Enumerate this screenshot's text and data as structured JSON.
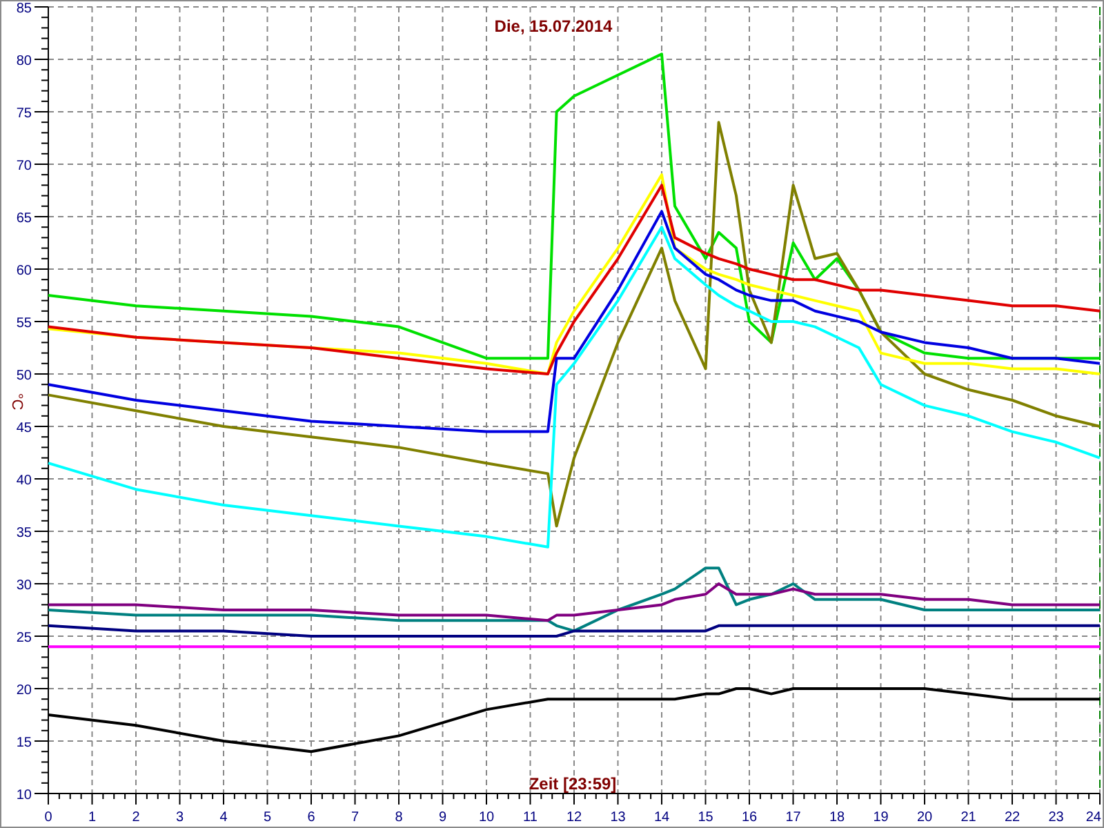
{
  "chart_data": {
    "type": "line",
    "title": "Die, 15.07.2014",
    "xlabel": "Zeit [23:59]",
    "ylabel": "°C",
    "x": [
      0,
      2,
      4,
      6,
      8,
      10,
      11.4,
      11.6,
      12,
      13,
      14,
      14.3,
      15,
      15.3,
      15.7,
      16,
      16.5,
      17,
      17.5,
      18,
      18.5,
      19,
      20,
      21,
      22,
      23,
      24
    ],
    "grid": true,
    "xlim": [
      0,
      24
    ],
    "ylim": [
      10,
      85
    ],
    "xticks": [
      0,
      1,
      2,
      3,
      4,
      5,
      6,
      7,
      8,
      9,
      10,
      11,
      12,
      13,
      14,
      15,
      16,
      17,
      18,
      19,
      20,
      21,
      22,
      23,
      24
    ],
    "yticks": [
      10,
      15,
      20,
      25,
      30,
      35,
      40,
      45,
      50,
      55,
      60,
      65,
      70,
      75,
      80,
      85
    ],
    "series": [
      {
        "color": "#00e000",
        "values": [
          57.5,
          56.5,
          56,
          55.5,
          54.5,
          51.5,
          51.5,
          75,
          76.5,
          78.5,
          80.5,
          66,
          61,
          63.5,
          62,
          55,
          53,
          62.5,
          59,
          61,
          58,
          54,
          52,
          51.5,
          51.5,
          51.5,
          51.5
        ]
      },
      {
        "color": "#808000",
        "values": [
          48,
          46.5,
          45,
          44,
          43,
          41.5,
          40.5,
          35.5,
          42,
          53,
          62,
          57,
          50.5,
          74,
          67,
          58,
          53,
          68,
          61,
          61.5,
          58,
          54,
          50,
          48.5,
          47.5,
          46,
          45
        ]
      },
      {
        "color": "#ffff00",
        "values": [
          54.3,
          53.5,
          53,
          52.5,
          52,
          51,
          50,
          53,
          56,
          62,
          69,
          62,
          60,
          59.5,
          59,
          58.5,
          58,
          57.5,
          57,
          56.5,
          56,
          52,
          51,
          51,
          50.5,
          50.5,
          50
        ]
      },
      {
        "color": "#e00000",
        "values": [
          54.5,
          53.5,
          53,
          52.5,
          51.5,
          50.5,
          50,
          52,
          55,
          61,
          68,
          63,
          61.5,
          61,
          60.5,
          60,
          59.5,
          59,
          59,
          58.5,
          58,
          58,
          57.5,
          57,
          56.5,
          56.5,
          56
        ]
      },
      {
        "color": "#00ffff",
        "values": [
          41.5,
          39,
          37.5,
          36.5,
          35.5,
          34.5,
          33.5,
          49,
          51,
          57,
          64,
          61,
          58.5,
          57.5,
          56.5,
          56,
          55,
          55,
          54.5,
          53.5,
          52.5,
          49,
          47,
          46,
          44.5,
          43.5,
          42
        ]
      },
      {
        "color": "#0000e0",
        "values": [
          49,
          47.5,
          46.5,
          45.5,
          45,
          44.5,
          44.5,
          51.5,
          51.5,
          58,
          65.5,
          62,
          59.5,
          59,
          58,
          57.5,
          57,
          57,
          56,
          55.5,
          55,
          54,
          53,
          52.5,
          51.5,
          51.5,
          51
        ]
      },
      {
        "color": "#008080",
        "values": [
          27.5,
          27,
          27,
          27,
          26.5,
          26.5,
          26.5,
          26,
          25.5,
          27.5,
          29,
          29.5,
          31.5,
          31.5,
          28,
          28.5,
          29,
          30,
          28.5,
          28.5,
          28.5,
          28.5,
          27.5,
          27.5,
          27.5,
          27.5,
          27.5
        ]
      },
      {
        "color": "#800080",
        "values": [
          28,
          28,
          27.5,
          27.5,
          27,
          27,
          26.5,
          27,
          27,
          27.5,
          28,
          28.5,
          29,
          30,
          29,
          29,
          29,
          29.5,
          29,
          29,
          29,
          29,
          28.5,
          28.5,
          28,
          28,
          28
        ]
      },
      {
        "color": "#000080",
        "values": [
          26,
          25.5,
          25.5,
          25,
          25,
          25,
          25,
          25,
          25.5,
          25.5,
          25.5,
          25.5,
          25.5,
          26,
          26,
          26,
          26,
          26,
          26,
          26,
          26,
          26,
          26,
          26,
          26,
          26,
          26
        ]
      },
      {
        "color": "#ff00ff",
        "values": [
          24,
          24,
          24,
          24,
          24,
          24,
          24,
          24,
          24,
          24,
          24,
          24,
          24,
          24,
          24,
          24,
          24,
          24,
          24,
          24,
          24,
          24,
          24,
          24,
          24,
          24,
          24
        ]
      },
      {
        "color": "#000000",
        "values": [
          17.5,
          16.5,
          15,
          14,
          15.5,
          18,
          19,
          19,
          19,
          19,
          19,
          19,
          19.5,
          19.5,
          20,
          20,
          19.5,
          20,
          20,
          20,
          20,
          20,
          20,
          19.5,
          19,
          19,
          19
        ]
      }
    ]
  }
}
